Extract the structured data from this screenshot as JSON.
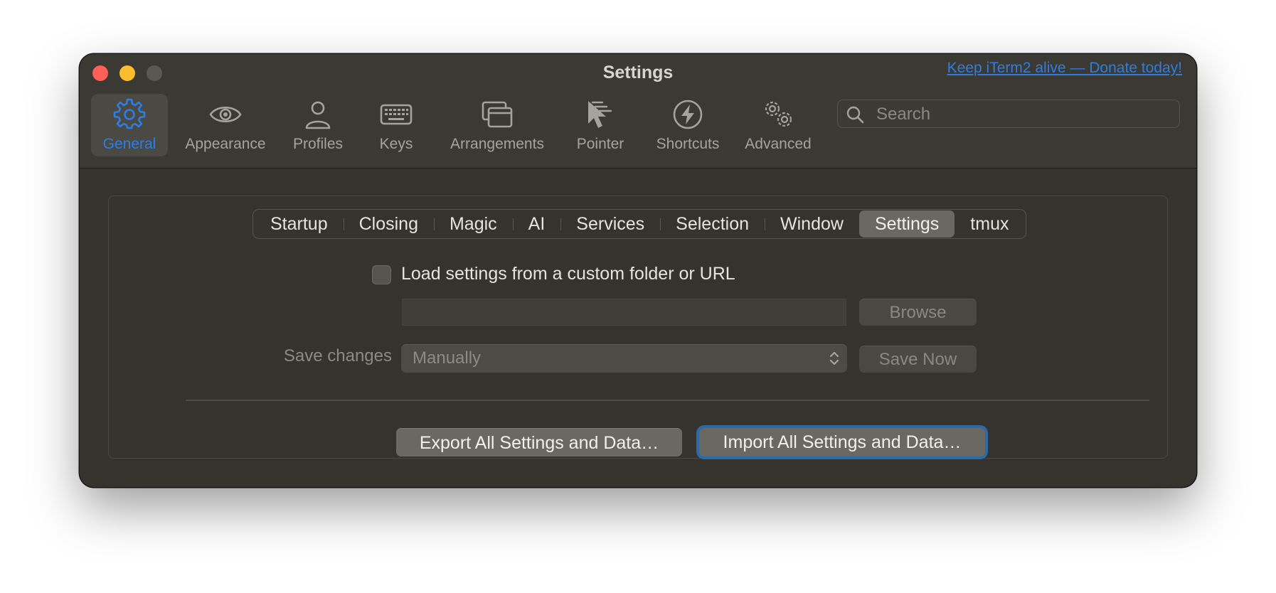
{
  "window": {
    "title": "Settings",
    "donate_link": "Keep iTerm2 alive — Donate today!"
  },
  "toolbar": {
    "items": [
      {
        "label": "General",
        "icon": "gear-icon",
        "selected": true
      },
      {
        "label": "Appearance",
        "icon": "eye-icon",
        "selected": false
      },
      {
        "label": "Profiles",
        "icon": "person-icon",
        "selected": false
      },
      {
        "label": "Keys",
        "icon": "keyboard-icon",
        "selected": false
      },
      {
        "label": "Arrangements",
        "icon": "windows-icon",
        "selected": false
      },
      {
        "label": "Pointer",
        "icon": "pointer-icon",
        "selected": false
      },
      {
        "label": "Shortcuts",
        "icon": "bolt-icon",
        "selected": false
      },
      {
        "label": "Advanced",
        "icon": "gears-icon",
        "selected": false
      }
    ],
    "search_placeholder": "Search"
  },
  "tabs": {
    "items": [
      "Startup",
      "Closing",
      "Magic",
      "AI",
      "Services",
      "Selection",
      "Window",
      "Settings",
      "tmux"
    ],
    "active": "Settings"
  },
  "settings_panel": {
    "load_checkbox_label": "Load settings from a custom folder or URL",
    "load_checkbox_checked": false,
    "path_value": "",
    "browse_button": "Browse",
    "save_changes_label": "Save changes",
    "save_changes_value": "Manually",
    "save_now_button": "Save Now",
    "export_button": "Export All Settings and Data…",
    "import_button": "Import All Settings and Data…"
  },
  "colors": {
    "accent": "#2d7ee4",
    "window_bg": "#36332e",
    "toolbar_bg": "#3b3934",
    "close": "#ff5f57",
    "minimize": "#febc2e"
  }
}
